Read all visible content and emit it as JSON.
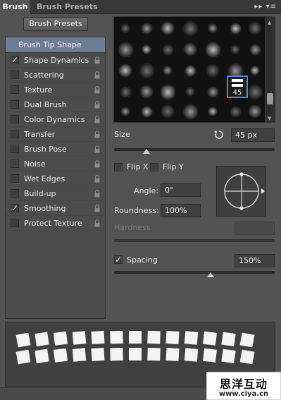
{
  "tabs": {
    "active": "Brush",
    "inactive": "Brush Presets",
    "menu_glyphs": "▸▸ ▾≡"
  },
  "presets_button": "Brush Presets",
  "tip_shape_label": "Brush Tip Shape",
  "options": [
    {
      "label": "Shape Dynamics",
      "checked": true
    },
    {
      "label": "Scattering",
      "checked": false
    },
    {
      "label": "Texture",
      "checked": false
    },
    {
      "label": "Dual Brush",
      "checked": false
    },
    {
      "label": "Color Dynamics",
      "checked": false
    },
    {
      "label": "Transfer",
      "checked": false
    },
    {
      "label": "Brush Pose",
      "checked": false
    },
    {
      "label": "Noise",
      "checked": false
    },
    {
      "label": "Wet Edges",
      "checked": false
    },
    {
      "label": "Build-up",
      "checked": false
    },
    {
      "label": "Smoothing",
      "checked": true
    },
    {
      "label": "Protect Texture",
      "checked": false
    }
  ],
  "selected_tip_size": "45",
  "size": {
    "label": "Size",
    "value": "45 px",
    "slider_fraction": 0.2
  },
  "flip_x": "Flip X",
  "flip_y": "Flip Y",
  "angle": {
    "label": "Angle:",
    "value": "0°"
  },
  "roundness": {
    "label": "Roundness:",
    "value": "100%"
  },
  "hardness": {
    "label": "Hardness"
  },
  "spacing": {
    "label": "Spacing",
    "value": "150%",
    "checked": true,
    "slider_fraction": 0.6
  },
  "watermark": {
    "title": "思洋互动",
    "url": "www.ciya.cn"
  }
}
